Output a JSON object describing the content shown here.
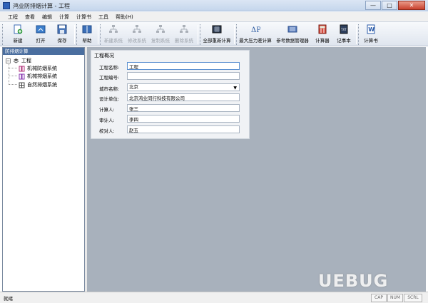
{
  "window": {
    "title": "鸿业防排烟计算 - 工程",
    "buttons": {
      "minimize": "—",
      "maximize": "□",
      "close": "✕"
    }
  },
  "menu": [
    "工程",
    "查看",
    "编辑",
    "计算",
    "计算书",
    "工具",
    "帮助(H)"
  ],
  "toolbar": {
    "new": "新建",
    "open": "打开",
    "save": "保存",
    "help": "帮助",
    "new_system": "新建系统",
    "edit_system": "修改系统",
    "copy_system": "复制系统",
    "delete_system": "删除系统",
    "recalc_all": "全部重新计算",
    "max_pressure": "最大压力差计算",
    "ref_data_manager": "参考数据管理器",
    "calculator": "计算器",
    "notepad": "记事本",
    "calc_book": "计算书"
  },
  "left_panel": {
    "header": "防排烟计算",
    "tree": {
      "root": "工程",
      "children": [
        "机械防烟系统",
        "机械排烟系统",
        "自然排烟系统"
      ]
    }
  },
  "form": {
    "group_title": "工程概况",
    "fields": [
      {
        "label": "工程名称:",
        "value": "工程"
      },
      {
        "label": "工程编号:",
        "value": ""
      },
      {
        "label": "城市名称:",
        "value": "北京"
      },
      {
        "label": "设计单位:",
        "value": "北京鸿业同行科技有限公司"
      },
      {
        "label": "计算人:",
        "value": "张三"
      },
      {
        "label": "审计人:",
        "value": "李四"
      },
      {
        "label": "校对人:",
        "value": "赵五"
      }
    ]
  },
  "status": {
    "text": "就绪",
    "panes": [
      "CAP",
      "NUM",
      "SCRL"
    ]
  },
  "watermark": "UEBUG",
  "colors": {
    "panel_header": "#4a6e9f",
    "content_bg": "#a8b1bc",
    "title_gradient_top": "#dbe6f4"
  }
}
